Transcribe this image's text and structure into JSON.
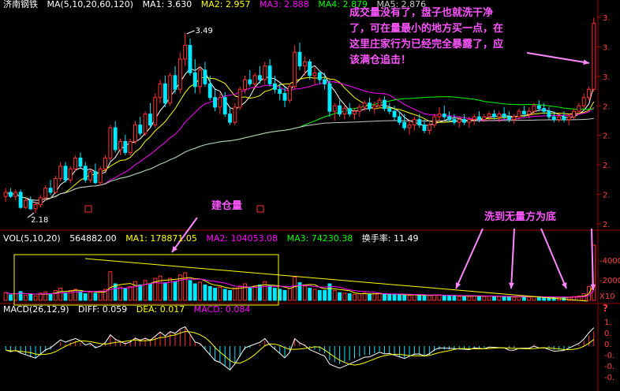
{
  "colors": {
    "price_up": "#ff3030",
    "price_down": "#00e8ff",
    "ma5": "#ffffff",
    "ma10": "#ffff00",
    "ma20": "#ff00ff",
    "ma60": "#00ff00",
    "ma120": "#c8c8c8",
    "note": "#ff55ff",
    "annotation_arrow": "#ff88ff",
    "trend_line": "#ffff00",
    "vol_box": "#ffff00",
    "axis": "#a00000"
  },
  "price_header": {
    "name": "济南钢铁",
    "label": "MA(5,10,20,60,120)",
    "ma1": "MA1: 3.630",
    "ma2": "MA2: 2.957",
    "ma3": "MA3: 2.888",
    "ma4": "MA4: 2.879",
    "ma5": "MA5: 2.876"
  },
  "annotations": {
    "top_note_lines": [
      "成交量没有了，盘子也就洗干净",
      "了，可在量最小的地方买一点，在",
      "这里庄家行为已经完全暴露了，应",
      "该满仓追击！"
    ],
    "build_label": "建仓量",
    "wash_label": "洗到无量方为底"
  },
  "price_axis_labels": [
    "3.",
    "3.",
    "3.",
    "2.",
    "2.",
    "2.",
    "2.",
    "2."
  ],
  "vol_axis_labels": [
    "-4000",
    "-2000",
    "X10"
  ],
  "macd_axis_labels": [
    "1.",
    "0.",
    "0.",
    "-0.",
    "-0.",
    "-0."
  ],
  "vol_header": {
    "label": "VOL(5,10,20)",
    "value": "564882.00",
    "ma1": "MA1: 178871.05",
    "ma2": "MA2: 104053.08",
    "ma3": "MA3: 74230.38",
    "turnover": "换手率: 11.49"
  },
  "macd_header": {
    "label": "MACD(26,12,9)",
    "diff": "DIFF: 0.059",
    "dea": "DEA: 0.017",
    "macd": "MACD: 0.084"
  },
  "chart_data": {
    "type": "candlestick",
    "price_high_label": "3.49",
    "price_low_label": "2.18",
    "candles": [
      [
        2.3,
        2.36,
        2.26,
        2.33
      ],
      [
        2.33,
        2.36,
        2.29,
        2.3
      ],
      [
        2.3,
        2.35,
        2.27,
        2.33
      ],
      [
        2.33,
        2.35,
        2.21,
        2.22
      ],
      [
        2.22,
        2.29,
        2.21,
        2.27
      ],
      [
        2.27,
        2.3,
        2.2,
        2.21
      ],
      [
        2.21,
        2.26,
        2.18,
        2.24
      ],
      [
        2.24,
        2.31,
        2.22,
        2.29
      ],
      [
        2.29,
        2.38,
        2.27,
        2.36
      ],
      [
        2.36,
        2.42,
        2.31,
        2.33
      ],
      [
        2.33,
        2.45,
        2.32,
        2.43
      ],
      [
        2.43,
        2.55,
        2.41,
        2.52
      ],
      [
        2.52,
        2.55,
        2.4,
        2.42
      ],
      [
        2.42,
        2.52,
        2.4,
        2.5
      ],
      [
        2.5,
        2.6,
        2.48,
        2.58
      ],
      [
        2.58,
        2.62,
        2.5,
        2.52
      ],
      [
        2.52,
        2.55,
        2.4,
        2.42
      ],
      [
        2.42,
        2.5,
        2.4,
        2.48
      ],
      [
        2.48,
        2.54,
        2.39,
        2.4
      ],
      [
        2.4,
        2.52,
        2.38,
        2.5
      ],
      [
        2.5,
        2.6,
        2.48,
        2.58
      ],
      [
        2.58,
        2.82,
        2.56,
        2.8
      ],
      [
        2.8,
        2.85,
        2.62,
        2.64
      ],
      [
        2.64,
        2.72,
        2.6,
        2.7
      ],
      [
        2.7,
        2.75,
        2.6,
        2.62
      ],
      [
        2.62,
        2.72,
        2.6,
        2.7
      ],
      [
        2.7,
        2.85,
        2.68,
        2.82
      ],
      [
        2.82,
        2.88,
        2.74,
        2.76
      ],
      [
        2.76,
        2.92,
        2.74,
        2.9
      ],
      [
        2.9,
        2.98,
        2.8,
        2.82
      ],
      [
        2.82,
        3.05,
        2.8,
        3.02
      ],
      [
        3.02,
        3.15,
        2.98,
        3.12
      ],
      [
        3.12,
        3.18,
        2.95,
        2.98
      ],
      [
        2.98,
        3.2,
        2.96,
        3.18
      ],
      [
        3.18,
        3.25,
        3.05,
        3.08
      ],
      [
        3.08,
        3.35,
        3.05,
        3.3
      ],
      [
        3.3,
        3.49,
        3.25,
        3.4
      ],
      [
        3.4,
        3.45,
        3.18,
        3.2
      ],
      [
        3.2,
        3.3,
        3.05,
        3.1
      ],
      [
        3.1,
        3.25,
        3.05,
        3.22
      ],
      [
        3.22,
        3.28,
        3.1,
        3.12
      ],
      [
        3.12,
        3.18,
        3.0,
        3.02
      ],
      [
        3.02,
        3.08,
        2.92,
        2.95
      ],
      [
        2.95,
        3.05,
        2.9,
        3.02
      ],
      [
        3.02,
        3.06,
        2.88,
        2.9
      ],
      [
        2.9,
        2.95,
        2.82,
        2.84
      ],
      [
        2.84,
        2.98,
        2.82,
        2.95
      ],
      [
        2.95,
        3.1,
        2.93,
        3.08
      ],
      [
        3.08,
        3.18,
        3.05,
        3.15
      ],
      [
        3.15,
        3.22,
        3.1,
        3.12
      ],
      [
        3.12,
        3.2,
        3.08,
        3.18
      ],
      [
        3.18,
        3.25,
        3.12,
        3.15
      ],
      [
        3.15,
        3.28,
        3.12,
        3.25
      ],
      [
        3.25,
        3.3,
        3.1,
        3.12
      ],
      [
        3.12,
        3.18,
        3.05,
        3.08
      ],
      [
        3.08,
        3.12,
        3.0,
        3.05
      ],
      [
        3.05,
        3.1,
        2.95,
        3.0
      ],
      [
        3.0,
        3.12,
        2.98,
        3.1
      ],
      [
        3.1,
        3.4,
        3.08,
        3.35
      ],
      [
        3.35,
        3.42,
        3.22,
        3.25
      ],
      [
        3.25,
        3.32,
        3.18,
        3.28
      ],
      [
        3.28,
        3.3,
        3.15,
        3.18
      ],
      [
        3.18,
        3.24,
        3.12,
        3.2
      ],
      [
        3.2,
        3.22,
        3.12,
        3.15
      ],
      [
        3.15,
        3.2,
        3.08,
        3.12
      ],
      [
        3.12,
        3.15,
        2.88,
        2.92
      ],
      [
        2.92,
        2.98,
        2.85,
        2.96
      ],
      [
        2.96,
        3.0,
        2.88,
        2.9
      ],
      [
        2.9,
        2.96,
        2.86,
        2.94
      ],
      [
        2.94,
        2.98,
        2.88,
        2.9
      ],
      [
        2.9,
        2.94,
        2.86,
        2.92
      ],
      [
        2.92,
        2.97,
        2.88,
        2.95
      ],
      [
        2.95,
        3.0,
        2.92,
        2.98
      ],
      [
        2.98,
        3.02,
        2.92,
        2.94
      ],
      [
        2.94,
        2.99,
        2.9,
        2.96
      ],
      [
        2.96,
        3.02,
        2.94,
        3.0
      ],
      [
        3.0,
        3.03,
        2.92,
        2.94
      ],
      [
        2.94,
        2.98,
        2.9,
        2.92
      ],
      [
        2.92,
        2.96,
        2.85,
        2.88
      ],
      [
        2.88,
        2.92,
        2.82,
        2.84
      ],
      [
        2.84,
        2.9,
        2.78,
        2.8
      ],
      [
        2.8,
        2.85,
        2.75,
        2.82
      ],
      [
        2.82,
        2.88,
        2.78,
        2.86
      ],
      [
        2.86,
        2.9,
        2.8,
        2.82
      ],
      [
        2.82,
        2.86,
        2.76,
        2.78
      ],
      [
        2.78,
        2.84,
        2.75,
        2.82
      ],
      [
        2.82,
        2.9,
        2.8,
        2.88
      ],
      [
        2.88,
        2.95,
        2.85,
        2.9
      ],
      [
        2.9,
        2.96,
        2.86,
        2.88
      ],
      [
        2.88,
        2.92,
        2.84,
        2.86
      ],
      [
        2.86,
        2.9,
        2.82,
        2.84
      ],
      [
        2.84,
        2.88,
        2.8,
        2.86
      ],
      [
        2.86,
        2.9,
        2.82,
        2.84
      ],
      [
        2.84,
        2.88,
        2.8,
        2.86
      ],
      [
        2.86,
        2.9,
        2.82,
        2.88
      ],
      [
        2.88,
        2.92,
        2.84,
        2.86
      ],
      [
        2.86,
        2.9,
        2.84,
        2.88
      ],
      [
        2.88,
        2.92,
        2.85,
        2.9
      ],
      [
        2.9,
        2.93,
        2.86,
        2.88
      ],
      [
        2.88,
        2.92,
        2.84,
        2.9
      ],
      [
        2.9,
        2.95,
        2.86,
        2.88
      ],
      [
        2.88,
        2.92,
        2.84,
        2.86
      ],
      [
        2.86,
        2.9,
        2.83,
        2.88
      ],
      [
        2.88,
        2.94,
        2.86,
        2.92
      ],
      [
        2.92,
        2.96,
        2.88,
        2.9
      ],
      [
        2.9,
        2.95,
        2.87,
        2.92
      ],
      [
        2.92,
        2.98,
        2.9,
        2.96
      ],
      [
        2.96,
        3.0,
        2.92,
        2.94
      ],
      [
        2.94,
        2.98,
        2.9,
        2.92
      ],
      [
        2.92,
        2.95,
        2.86,
        2.88
      ],
      [
        2.88,
        2.92,
        2.84,
        2.86
      ],
      [
        2.86,
        2.9,
        2.84,
        2.88
      ],
      [
        2.88,
        2.92,
        2.84,
        2.86
      ],
      [
        2.86,
        2.9,
        2.82,
        2.88
      ],
      [
        2.88,
        2.94,
        2.86,
        2.92
      ],
      [
        2.92,
        2.98,
        2.9,
        2.96
      ],
      [
        2.96,
        3.05,
        2.94,
        3.02
      ],
      [
        3.02,
        3.1,
        3.0,
        3.08
      ],
      [
        3.08,
        3.6,
        3.06,
        3.56
      ]
    ],
    "volume": [
      14,
      10,
      12,
      16,
      9,
      11,
      8,
      13,
      15,
      12,
      18,
      22,
      14,
      18,
      20,
      16,
      12,
      15,
      13,
      17,
      20,
      52,
      30,
      24,
      22,
      25,
      34,
      28,
      36,
      30,
      40,
      44,
      32,
      40,
      34,
      46,
      50,
      36,
      30,
      33,
      28,
      25,
      22,
      24,
      20,
      18,
      22,
      26,
      30,
      24,
      26,
      28,
      34,
      26,
      22,
      20,
      18,
      22,
      42,
      32,
      26,
      22,
      20,
      18,
      18,
      30,
      18,
      14,
      13,
      12,
      11,
      12,
      13,
      11,
      12,
      13,
      11,
      10,
      11,
      10,
      10,
      9,
      10,
      9,
      8,
      9,
      10,
      10,
      9,
      8,
      8,
      7,
      8,
      7,
      8,
      8,
      7,
      8,
      7,
      7,
      6,
      7,
      6,
      7,
      7,
      6,
      7,
      6,
      6,
      5,
      5,
      6,
      5,
      6,
      7,
      8,
      12,
      25,
      100
    ],
    "macd": [
      -0.02,
      -0.03,
      -0.025,
      -0.04,
      -0.05,
      -0.06,
      -0.07,
      -0.05,
      -0.03,
      -0.02,
      0.0,
      0.02,
      0.01,
      0.02,
      0.03,
      0.02,
      0.0,
      0.01,
      -0.01,
      0.0,
      0.02,
      0.06,
      0.04,
      0.03,
      0.02,
      0.03,
      0.05,
      0.04,
      0.05,
      0.04,
      0.06,
      0.08,
      0.06,
      0.08,
      0.07,
      0.09,
      0.1,
      0.06,
      0.02,
      0.01,
      -0.02,
      -0.05,
      -0.08,
      -0.09,
      -0.11,
      -0.13,
      -0.1,
      -0.06,
      -0.02,
      -0.01,
      0.0,
      0.01,
      0.03,
      0.0,
      -0.02,
      -0.04,
      -0.06,
      -0.03,
      0.04,
      0.02,
      0.01,
      -0.01,
      -0.02,
      -0.03,
      -0.04,
      -0.08,
      -0.09,
      -0.1,
      -0.09,
      -0.08,
      -0.07,
      -0.06,
      -0.05,
      -0.05,
      -0.04,
      -0.03,
      -0.04,
      -0.04,
      -0.05,
      -0.06,
      -0.07,
      -0.06,
      -0.05,
      -0.05,
      -0.06,
      -0.05,
      -0.03,
      -0.02,
      -0.02,
      -0.02,
      -0.02,
      -0.02,
      -0.02,
      -0.02,
      -0.01,
      -0.01,
      -0.01,
      0.0,
      0.0,
      0.0,
      0.0,
      -0.01,
      -0.01,
      0.0,
      0.0,
      0.0,
      0.01,
      0.0,
      0.0,
      -0.01,
      -0.02,
      -0.02,
      -0.02,
      -0.01,
      0.0,
      0.01,
      0.03,
      0.06,
      0.084
    ]
  }
}
